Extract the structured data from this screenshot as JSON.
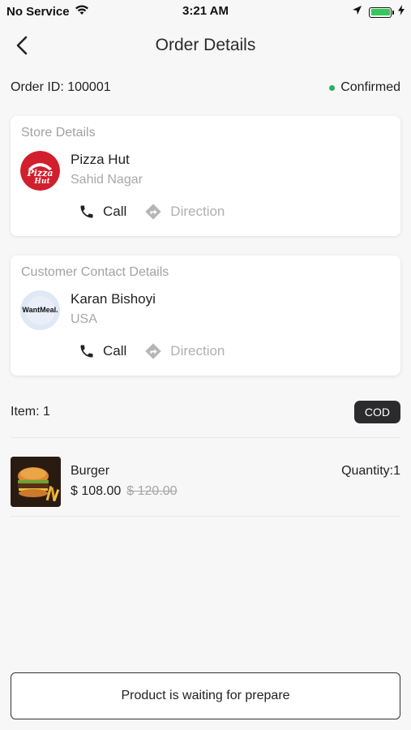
{
  "status_bar": {
    "carrier": "No Service",
    "time": "3:21 AM"
  },
  "nav": {
    "title": "Order Details"
  },
  "order": {
    "id_text": "Order ID: 100001",
    "status": "Confirmed",
    "status_color": "#29b35a"
  },
  "store": {
    "section_title": "Store Details",
    "name": "Pizza Hut",
    "location": "Sahid Nagar",
    "call_label": "Call",
    "direction_label": "Direction",
    "logo_text_1": "Pizza",
    "logo_text_2": "Hut"
  },
  "customer": {
    "section_title": "Customer Contact Details",
    "name": "Karan Bishoyi",
    "location": "USA",
    "call_label": "Call",
    "direction_label": "Direction",
    "logo_text_1": "Want",
    "logo_text_2": "Meal."
  },
  "items": {
    "count_text": "Item: 1",
    "payment_badge": "COD"
  },
  "products": [
    {
      "name": "Burger",
      "price": "$ 108.00",
      "original_price": "$ 120.00",
      "quantity": "Quantity:1"
    }
  ],
  "footer": {
    "button_label": "Product is waiting for prepare"
  },
  "colors": {
    "battery": "#35c759",
    "badge_bg": "#2b2b2d",
    "pizza_hut_red": "#d21f2d"
  },
  "icons": [
    "wifi-icon",
    "location-arrow-icon",
    "battery-icon",
    "charging-bolt-icon",
    "back-chevron-icon",
    "phone-icon",
    "direction-icon"
  ]
}
